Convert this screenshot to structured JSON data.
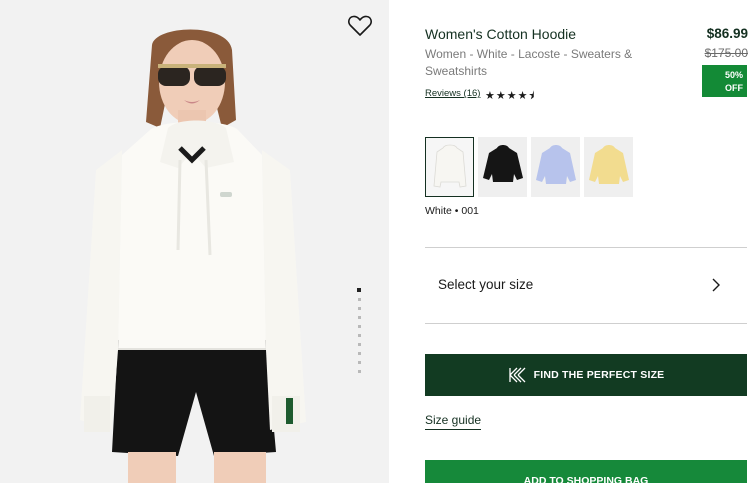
{
  "product": {
    "title": "Women's Cotton Hoodie",
    "subtitle": "Women - White - Lacoste - Sweaters & Sweatshirts",
    "reviews_label": "Reviews (16)",
    "rating_stars": "★★★★⯨",
    "rating": 4.5,
    "price": "$86.99",
    "old_price": "$175.00",
    "discount_line1": "50%",
    "discount_line2": "OFF"
  },
  "colors": {
    "selected_label": "White • 001",
    "swatches": [
      {
        "name": "white",
        "hex": "#f7f6f2"
      },
      {
        "name": "black",
        "hex": "#151515"
      },
      {
        "name": "light-blue",
        "hex": "#b7c3ec"
      },
      {
        "name": "yellow",
        "hex": "#f2dc8f"
      }
    ]
  },
  "size": {
    "select_label": "Select your size",
    "fit_button_label": "FIND THE PERFECT SIZE",
    "guide_label": "Size guide"
  },
  "cart": {
    "add_label": "ADD TO SHOPPING BAG"
  },
  "gallery": {
    "total_images": 7,
    "active_index": 0
  },
  "theme": {
    "brand_green": "#123b22",
    "accent_green": "#16893a"
  }
}
